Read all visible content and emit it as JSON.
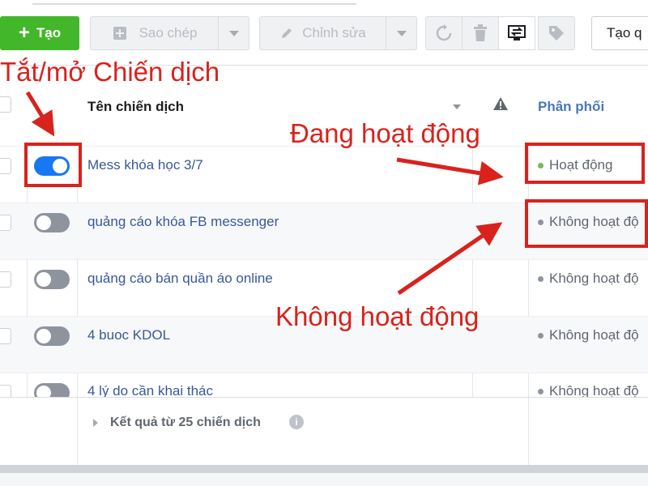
{
  "toolbar": {
    "create_label": "Tạo",
    "duplicate_label": "Sao chép",
    "edit_label": "Chỉnh sửa",
    "create_from_label": "Tạo q"
  },
  "table": {
    "header_name": "Tên chiến dịch",
    "header_delivery": "Phân phối",
    "rows": [
      {
        "name": "Mess khóa học 3/7",
        "status": "Hoạt động",
        "toggle_on": true
      },
      {
        "name": "quảng cáo khóa FB messenger",
        "status": "Không hoạt độ"
      },
      {
        "name": "quảng cáo bán quần áo online",
        "status": "Không hoạt độ"
      },
      {
        "name": "4 buoc KDOL",
        "status": "Không hoạt độ"
      },
      {
        "name": "4 lý do cần khai thác",
        "status": "Không hoạt độ"
      }
    ],
    "footer": "Kết quả từ 25 chiến dịch"
  },
  "annotations": {
    "toggle_note": "Tắt/mở Chiến dịch",
    "active_note": "Đang hoạt động",
    "inactive_note": "Không hoạt động"
  },
  "colors": {
    "create_green": "#42b72a",
    "toggle_on": "#1877f2",
    "annotation_red": "#d9221c",
    "active_dot": "#7bb84f"
  }
}
